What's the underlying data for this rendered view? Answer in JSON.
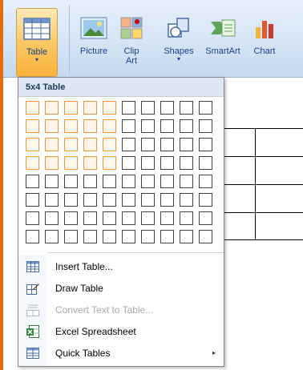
{
  "ribbon": {
    "buttons": [
      {
        "id": "table",
        "label": "Table",
        "has_arrow": true,
        "active": true,
        "icon": "table-icon"
      },
      {
        "id": "picture",
        "label": "Picture",
        "icon": "picture-icon"
      },
      {
        "id": "clipart",
        "label": "Clip Art",
        "label_line1": "Clip",
        "label_line2": "Art",
        "icon": "clip-art-icon"
      },
      {
        "id": "shapes",
        "label": "Shapes",
        "has_arrow": true,
        "icon": "shapes-icon"
      },
      {
        "id": "smartart",
        "label": "SmartArt",
        "icon": "smartart-icon"
      },
      {
        "id": "chart",
        "label": "Chart",
        "icon": "chart-icon"
      }
    ],
    "arrow_glyph": "▾"
  },
  "dropdown": {
    "header": "5x4 Table",
    "grid": {
      "columns": 10,
      "rows": 8,
      "selected_columns": 5,
      "selected_rows": 4
    },
    "menu_items": [
      {
        "label": "Insert Table...",
        "icon": "insert-table-icon",
        "enabled": true
      },
      {
        "label": "Draw Table",
        "icon": "draw-table-icon",
        "enabled": true
      },
      {
        "label": "Convert Text to Table...",
        "icon": "convert-text-icon",
        "enabled": false
      },
      {
        "label": "Excel Spreadsheet",
        "icon": "excel-spreadsheet-icon",
        "enabled": true
      },
      {
        "label": "Quick Tables",
        "icon": "quick-tables-icon",
        "enabled": true,
        "submenu": true
      }
    ],
    "submenu_glyph": "▸"
  },
  "colors": {
    "accent_orange": "#e46c0a",
    "selected_cell_border": "#f29436",
    "ribbon_text": "#15428b"
  }
}
